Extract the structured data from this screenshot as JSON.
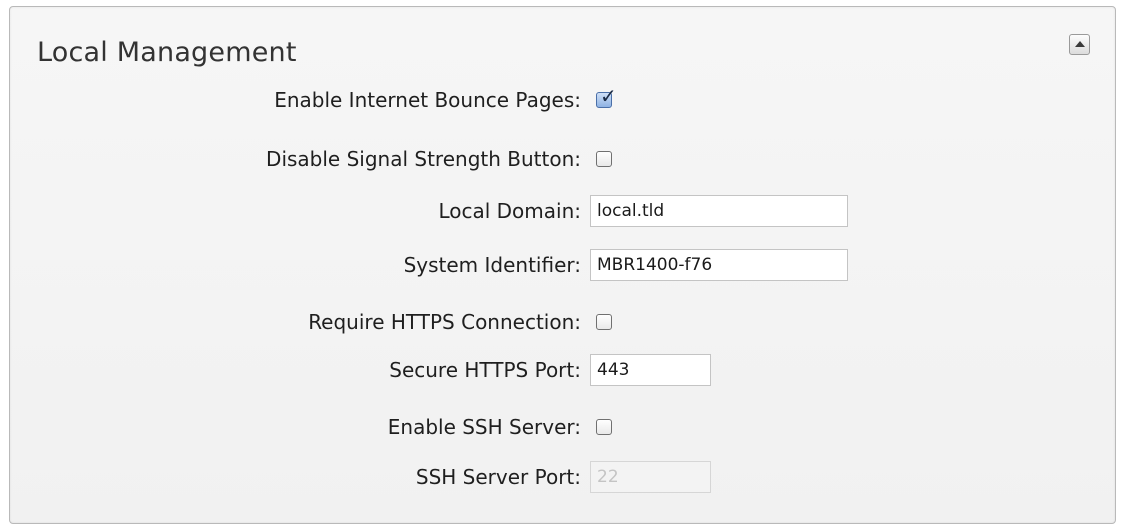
{
  "panel": {
    "title": "Local Management",
    "collapse_icon": "triangle-up-icon"
  },
  "fields": {
    "bounce_pages": {
      "label": "Enable Internet Bounce Pages:",
      "checked": true
    },
    "signal_button": {
      "label": "Disable Signal Strength Button:",
      "checked": false
    },
    "local_domain": {
      "label": "Local Domain:",
      "value": "local.tld"
    },
    "system_identifier": {
      "label": "System Identifier:",
      "value": "MBR1400-f76"
    },
    "require_https": {
      "label": "Require HTTPS Connection:",
      "checked": false
    },
    "https_port": {
      "label": "Secure HTTPS Port:",
      "value": "443"
    },
    "ssh_server": {
      "label": "Enable SSH Server:",
      "checked": false
    },
    "ssh_port": {
      "label": "SSH Server Port:",
      "value": "22",
      "disabled": true
    }
  }
}
